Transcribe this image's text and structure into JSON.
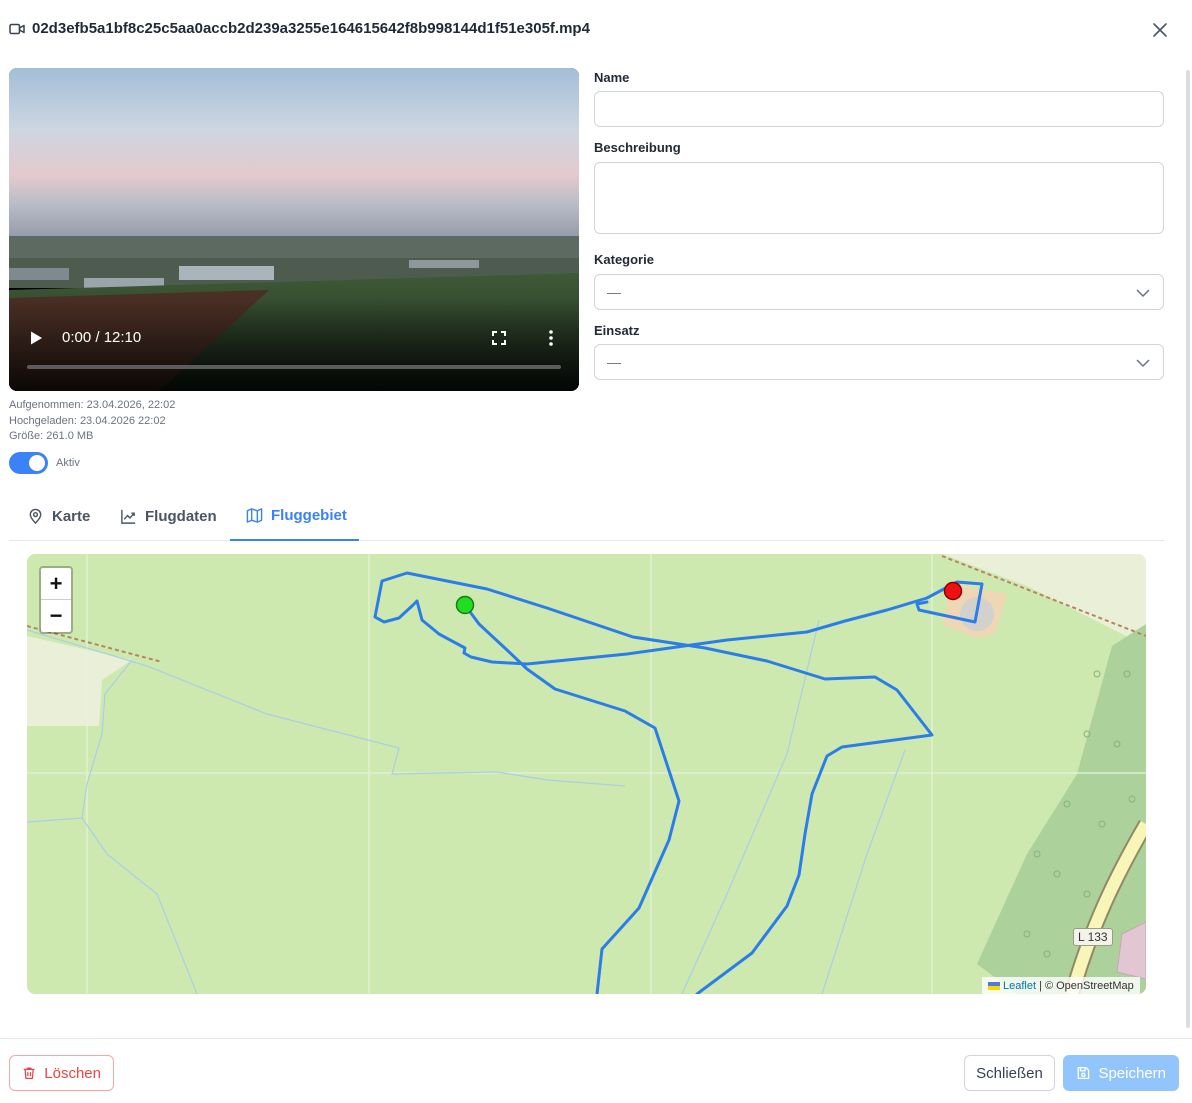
{
  "header": {
    "title": "02d3efb5a1bf8c25c5aa0accb2d239a3255e164615642f8b998144d1f51e305f.mp4",
    "icon": "video-icon",
    "close_icon": "close-icon"
  },
  "video": {
    "time": "0:00 / 12:10",
    "progress": 0
  },
  "meta": {
    "recorded": "Aufgenommen: 23.04.2026, 22:02",
    "uploaded": "Hochgeladen: 23.04.2026 22:02",
    "size": "Größe: 261.0 MB"
  },
  "active_toggle": {
    "label": "Aktiv",
    "on": true
  },
  "form": {
    "name_label": "Name",
    "name_value": "",
    "description_label": "Beschreibung",
    "description_value": "",
    "category_label": "Kategorie",
    "category_value": "—",
    "mission_label": "Einsatz",
    "mission_value": "—"
  },
  "tabs": [
    {
      "label": "Karte",
      "icon": "map-pin-icon",
      "active": false
    },
    {
      "label": "Flugdaten",
      "icon": "line-chart-icon",
      "active": false
    },
    {
      "label": "Fluggebiet",
      "icon": "map-icon",
      "active": true
    }
  ],
  "map": {
    "zoom_in": "+",
    "zoom_out": "−",
    "road_label": "L 133",
    "attribution_link": "Leaflet",
    "attribution_text": "| © OpenStreetMap",
    "colors": {
      "track": "#2b7de9",
      "start_marker": "#22dd22",
      "end_marker": "#ee1111",
      "background": "#cde9b0"
    }
  },
  "footer": {
    "delete_label": "Löschen",
    "close_label": "Schließen",
    "save_label": "Speichern"
  },
  "colors": {
    "accent": "#3b82f6",
    "danger": "#ef4444"
  }
}
